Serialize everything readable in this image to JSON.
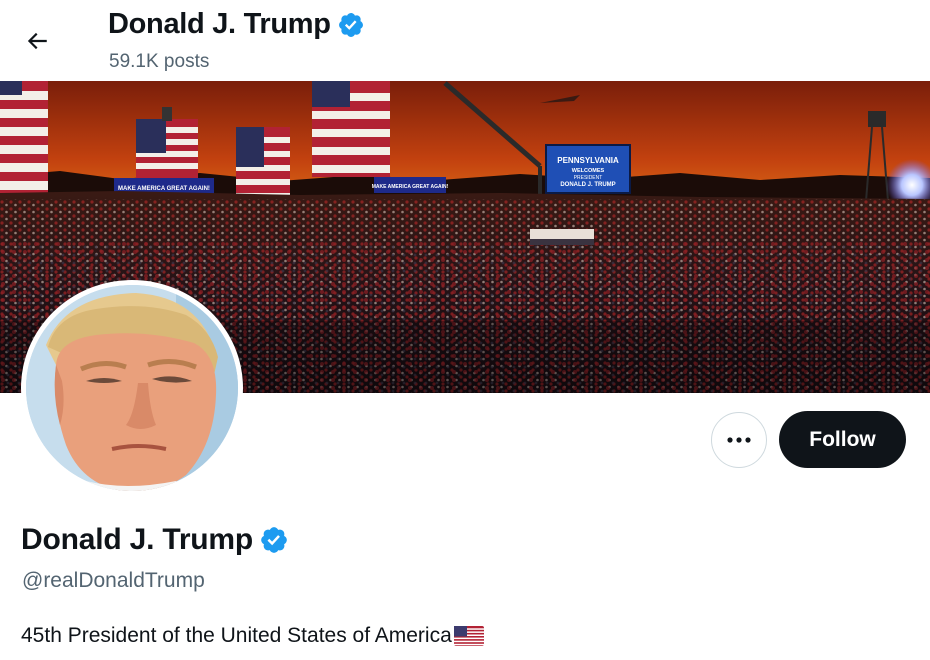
{
  "header": {
    "name": "Donald J. Trump",
    "posts": "59.1K posts"
  },
  "banner": {
    "signs": [
      "MAKE AMERICA GREAT AGAIN!",
      "MAKE AMERICA GREAT AGAIN!"
    ],
    "screen": [
      "PENNSYLVANIA",
      "WELCOMES",
      "PRESIDENT",
      "DONALD J. TRUMP"
    ]
  },
  "profile": {
    "name": "Donald J. Trump",
    "handle": "@realDonaldTrump",
    "bio": "45th President of the United States of America"
  },
  "actions": {
    "follow_label": "Follow",
    "more_label": "···"
  },
  "colors": {
    "verified": "#1d9bf0",
    "follow_bg": "#0f1419",
    "secondary_text": "#536471"
  },
  "icons": {
    "back": "arrow-left-icon",
    "verified": "verified-badge-icon",
    "more": "more-dots-icon",
    "flag": "us-flag-emoji"
  }
}
